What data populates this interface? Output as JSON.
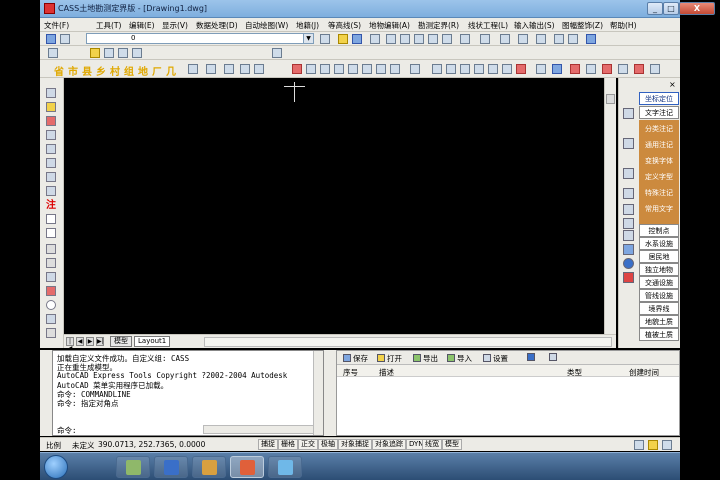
{
  "window": {
    "title": "CASS土地勘测定界版 - [Drawing1.dwg]",
    "min_label": "_",
    "max_label": "□",
    "close_label": "X"
  },
  "menu": [
    "文件(F)",
    "工具(T)",
    "编辑(E)",
    "显示(V)",
    "数据处理(D)",
    "自动绘图(W)",
    "地籍(J)",
    "等高线(S)",
    "地物编辑(A)",
    "勘测定界(R)",
    "线状工程(L)",
    "输入输出(S)",
    "图幅整饰(Z)",
    "帮助(H)"
  ],
  "layer_combo": {
    "value": "0"
  },
  "cass_toolbar": [
    "省",
    "市",
    "县",
    "乡",
    "村",
    "组",
    "地",
    "ㄏ",
    "几"
  ],
  "left_toolbar_label": "注",
  "layout_tabs": [
    "模型",
    "Layout1"
  ],
  "right_panel": {
    "top_button": "坐标定位",
    "orange_items": [
      "文字注记",
      "分类注记",
      "通用注记",
      "变换字体",
      "定义字型",
      "特殊注记",
      "常用文字"
    ],
    "white_items": [
      "控制点",
      "水系设施",
      "居民地",
      "独立地物",
      "交通设施",
      "管线设施",
      "境界线",
      "地貌土质",
      "植被土质"
    ]
  },
  "command_lines": [
    "加载自定义文件成功。自定义组: CASS",
    "正在重生成模型。",
    "AutoCAD Express Tools Copyright ?2002-2004 Autodesk",
    "AutoCAD 菜单实用程序已加载。",
    "命令: COMMANDLINE",
    "命令: 指定对角点"
  ],
  "command_prompt": "命令:",
  "query_panel": {
    "buttons": [
      "保存",
      "打开",
      "导出",
      "导入",
      "设置"
    ],
    "columns": [
      "序号",
      "描述",
      "类型",
      "创建时间"
    ]
  },
  "status": {
    "scale_label": "比例",
    "scale_value": "未定义",
    "coords": "390.0713, 252.7365, 0.0000",
    "toggles": [
      "捕捉",
      "栅格",
      "正交",
      "极轴",
      "对象捕捉",
      "对象追踪",
      "DYN",
      "线宽",
      "模型"
    ]
  },
  "colors": {
    "canvas": "#000000",
    "panel_orange": "#cc8a3e",
    "cass_label": "#e0a800",
    "title_bar": "#9cc4ea"
  }
}
